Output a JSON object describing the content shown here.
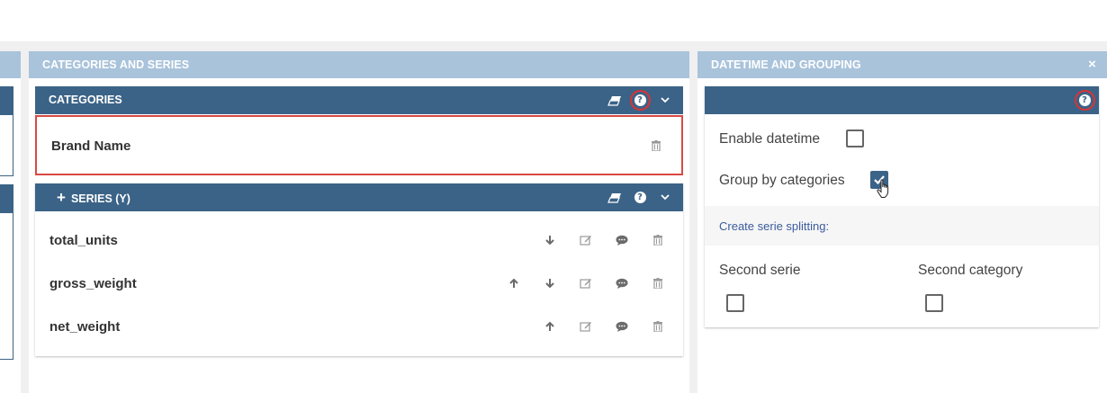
{
  "categories_panel": {
    "title": "CATEGORIES AND SERIES",
    "categories": {
      "header": "CATEGORIES",
      "item": "Brand Name"
    },
    "series": {
      "header": "SERIES (Y)",
      "add_symbol": "+",
      "items": [
        {
          "label": "total_units"
        },
        {
          "label": "gross_weight"
        },
        {
          "label": "net_weight"
        }
      ]
    }
  },
  "datetime_panel": {
    "title": "DATETIME AND GROUPING",
    "close_symbol": "×",
    "help_symbol": "?",
    "enable_datetime_label": "Enable datetime",
    "enable_datetime_checked": false,
    "group_by_label": "Group by categories",
    "group_by_checked": true,
    "split_link": "Create serie splitting:",
    "second_serie_label": "Second serie",
    "second_serie_checked": false,
    "second_category_label": "Second category",
    "second_category_checked": false
  },
  "icons": {
    "help": "question-circle-icon",
    "eraser": "eraser-icon",
    "collapse": "chevron-down-icon",
    "delete": "trash-icon",
    "up": "arrow-up-icon",
    "down": "arrow-down-icon",
    "edit": "edit-icon",
    "comment": "comment-icon",
    "close": "close-icon",
    "check": "check-icon",
    "cursor": "hand-pointer-icon"
  },
  "colors": {
    "panel_header": "#a9c3db",
    "section_bar": "#3b6387",
    "highlight": "#d84a44",
    "link": "#3b5c9e"
  }
}
